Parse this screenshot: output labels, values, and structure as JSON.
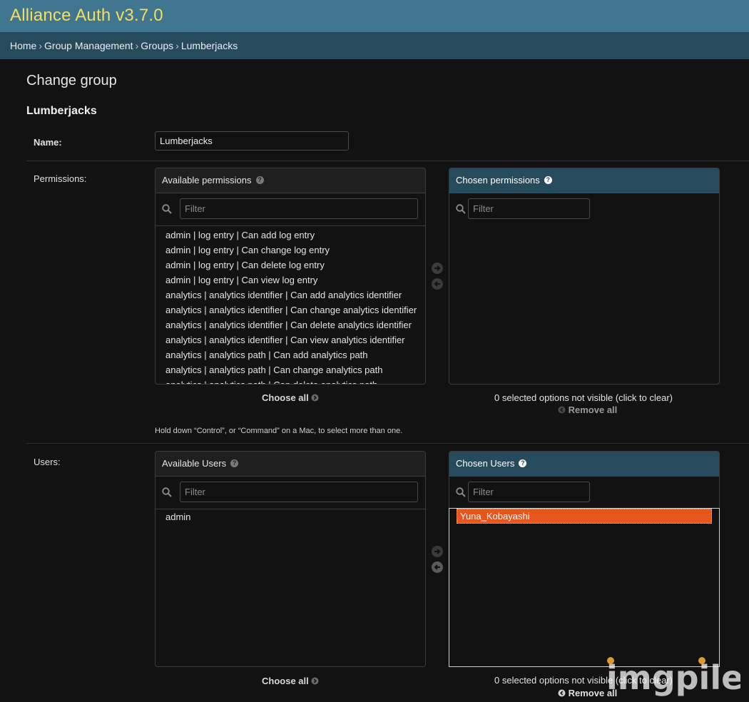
{
  "header": {
    "title": "Alliance Auth v3.7.0"
  },
  "breadcrumbs": [
    "Home",
    "Group Management",
    "Groups",
    "Lumberjacks"
  ],
  "page_title": "Change group",
  "object_title": "Lumberjacks",
  "name_field": {
    "label": "Name:",
    "value": "Lumberjacks"
  },
  "permissions": {
    "label": "Permissions:",
    "available_title": "Available permissions",
    "chosen_title": "Chosen permissions",
    "filter_placeholder": "Filter",
    "available": [
      "admin | log entry | Can add log entry",
      "admin | log entry | Can change log entry",
      "admin | log entry | Can delete log entry",
      "admin | log entry | Can view log entry",
      "analytics | analytics identifier | Can add analytics identifier",
      "analytics | analytics identifier | Can change analytics identifier",
      "analytics | analytics identifier | Can delete analytics identifier",
      "analytics | analytics identifier | Can view analytics identifier",
      "analytics | analytics path | Can add analytics path",
      "analytics | analytics path | Can change analytics path",
      "analytics | analytics path | Can delete analytics path"
    ],
    "choose_all": "Choose all",
    "remove_all": "Remove all",
    "not_visible": "0 selected options not visible (click to clear)",
    "help_text": "Hold down “Control”, or “Command” on a Mac, to select more than one."
  },
  "users": {
    "label": "Users:",
    "available_title": "Available Users",
    "chosen_title": "Chosen Users",
    "filter_placeholder": "Filter",
    "available": [
      "admin"
    ],
    "chosen": [
      "Yuna_Kobayashi"
    ],
    "choose_all": "Choose all",
    "remove_all": "Remove all",
    "not_visible": "0 selected options not visible (click to clear)"
  },
  "watermark": "imgpile",
  "colors": {
    "header_bg": "#417690",
    "header_title": "#f5dd5d",
    "breadcrumb_bg": "#264b5d",
    "chosen_header_bg": "#264b5d",
    "selected_option_bg": "#e8561d",
    "page_bg": "#121212"
  }
}
